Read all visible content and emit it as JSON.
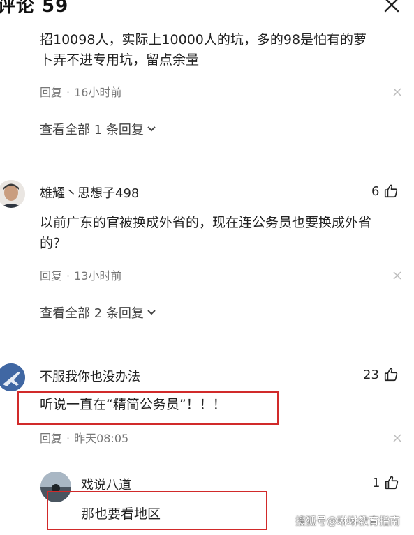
{
  "header": {
    "title": "评论 59"
  },
  "comment0": {
    "line1": "招10098人，实际上10000人的坑，多的98是怕有的萝",
    "line2": "卜弄不进专用坑，留点余量",
    "reply_label": "回复",
    "time": "16小时前",
    "view_all": "查看全部 1 条回复"
  },
  "comment1": {
    "username": "雄耀丶思想子498",
    "likes": "6",
    "line1": "以前广东的官被换成外省的，现在连公务员也要换成外省",
    "line2": "的？",
    "reply_label": "回复",
    "time": "13小时前",
    "view_all": "查看全部 2 条回复"
  },
  "comment2": {
    "username": "不服我你也没办法",
    "likes": "23",
    "text": "听说一直在“精简公务员”！！！",
    "reply_label": "回复",
    "time": "昨天08:05"
  },
  "reply1": {
    "username": "戏说八道",
    "likes": "1",
    "text": "那也要看地区"
  },
  "watermark": "搜狐号@琳琳教育指南",
  "colors": {
    "highlight_border": "#d12a2a",
    "meta_gray": "#777777"
  }
}
